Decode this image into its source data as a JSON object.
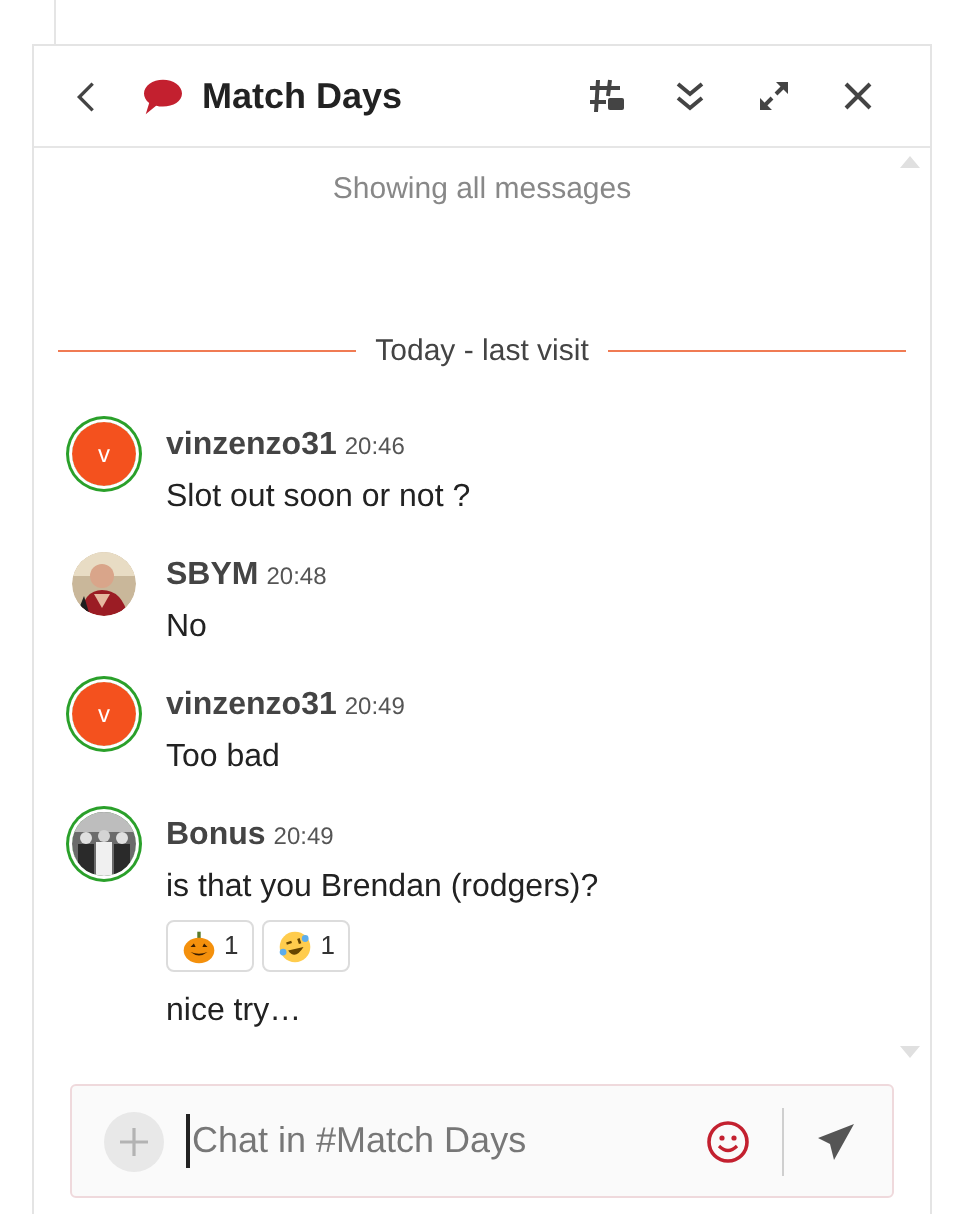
{
  "header": {
    "title": "Match Days"
  },
  "history_note": "Showing all messages",
  "divider": "Today - last visit",
  "messages": [
    {
      "avatar": {
        "kind": "letter",
        "letter": "v"
      },
      "online": true,
      "author": "vinzenzo31",
      "time": "20:46",
      "lines": [
        {
          "text": "Slot out soon or not ?"
        }
      ]
    },
    {
      "avatar": {
        "kind": "picture"
      },
      "online": false,
      "author": "SBYM",
      "time": "20:48",
      "lines": [
        {
          "text": "No"
        }
      ]
    },
    {
      "avatar": {
        "kind": "letter",
        "letter": "v"
      },
      "online": true,
      "author": "vinzenzo31",
      "time": "20:49",
      "lines": [
        {
          "text": "Too bad"
        }
      ]
    },
    {
      "avatar": {
        "kind": "picture"
      },
      "online": true,
      "author": "Bonus",
      "time": "20:49",
      "lines": [
        {
          "text": "is that you Brendan (rodgers)?",
          "reactions": [
            {
              "kind": "pumpkin",
              "count": "1"
            },
            {
              "kind": "laughing",
              "count": "1"
            }
          ]
        },
        {
          "text": "nice try…"
        }
      ]
    }
  ],
  "composer": {
    "placeholder": "Chat in #Match Days"
  }
}
